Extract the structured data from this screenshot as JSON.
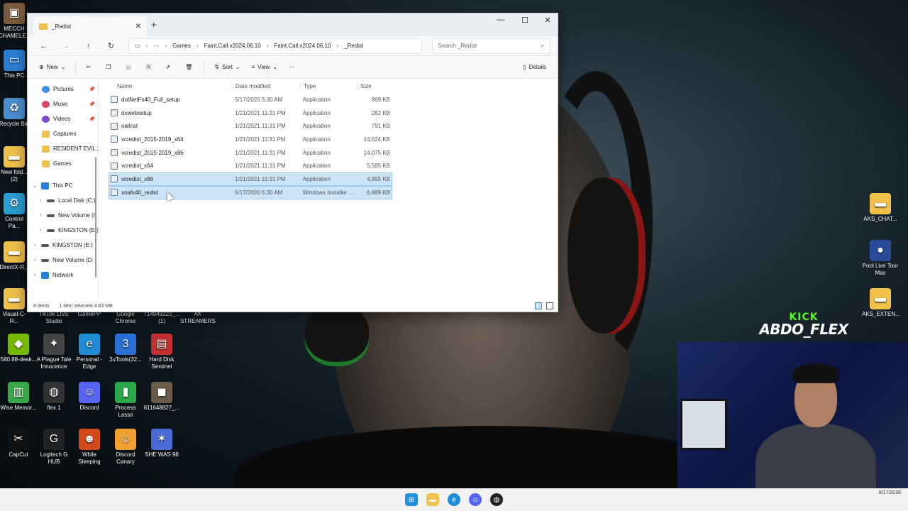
{
  "window": {
    "tab_title": "_Redist",
    "close_tab": "✕",
    "new_tab": "+",
    "minimize": "—",
    "maximize": "☐",
    "close": "✕"
  },
  "address": {
    "crumbs": [
      "Games",
      "Faint.Call.v2024.06.10",
      "Faint.Call.v2024.06.10",
      "_Redist"
    ],
    "search_placeholder": "Search _Redist",
    "more": "···"
  },
  "toolbar": {
    "new_label": "New",
    "sort_label": "Sort",
    "view_label": "View",
    "more": "···",
    "details_label": "Details"
  },
  "sidebar": {
    "items": [
      {
        "label": "Pictures",
        "icon": "pictures-icon",
        "color": "#3a8ee6",
        "pinned": true
      },
      {
        "label": "Music",
        "icon": "music-icon",
        "color": "#d6496b",
        "pinned": true
      },
      {
        "label": "Videos",
        "icon": "videos-icon",
        "color": "#7a4ac9",
        "pinned": true
      },
      {
        "label": "Captures",
        "icon": "folder-icon",
        "color": "#f0c14b",
        "pinned": false
      },
      {
        "label": "RESIDENT EVIL 2",
        "icon": "folder-icon",
        "color": "#f0c14b",
        "pinned": false
      },
      {
        "label": "Games",
        "icon": "folder-icon",
        "color": "#f0c14b",
        "pinned": false
      }
    ],
    "tree": [
      {
        "label": "This PC",
        "icon": "computer-icon",
        "chev": "⌄",
        "indent": 0
      },
      {
        "label": "Local Disk (C:)",
        "icon": "drive-icon",
        "chev": "›",
        "indent": 1
      },
      {
        "label": "New Volume (I",
        "icon": "drive-icon",
        "chev": "›",
        "indent": 1
      },
      {
        "label": "KINGSTON (E:)",
        "icon": "drive-icon",
        "chev": "›",
        "indent": 1
      },
      {
        "label": "KINGSTON (E:)",
        "icon": "drive-icon",
        "chev": "›",
        "indent": 0
      },
      {
        "label": "New Volume (D:",
        "icon": "drive-icon",
        "chev": "›",
        "indent": 0
      },
      {
        "label": "Network",
        "icon": "network-icon",
        "chev": "›",
        "indent": 0
      }
    ]
  },
  "files": {
    "columns": [
      "Name",
      "Date modified",
      "Type",
      "Size"
    ],
    "rows": [
      {
        "name": "dotNetFx40_Full_setup",
        "date": "5/17/2020 5:30 AM",
        "type": "Application",
        "size": "869 KB",
        "selected": false
      },
      {
        "name": "dxwebsetup",
        "date": "1/21/2021 11:31 PM",
        "type": "Application",
        "size": "282 KB",
        "selected": false
      },
      {
        "name": "oalinst",
        "date": "1/21/2021 11:31 PM",
        "type": "Application",
        "size": "791 KB",
        "selected": false
      },
      {
        "name": "vcredist_2015-2019_x64",
        "date": "1/21/2021 11:31 PM",
        "type": "Application",
        "size": "14,624 KB",
        "selected": false
      },
      {
        "name": "vcredist_2015-2019_x86",
        "date": "1/21/2021 11:31 PM",
        "type": "Application",
        "size": "14,075 KB",
        "selected": false
      },
      {
        "name": "vcredist_x64",
        "date": "1/21/2021 11:31 PM",
        "type": "Application",
        "size": "5,585 KB",
        "selected": false
      },
      {
        "name": "vcredist_x86",
        "date": "1/21/2021 11:31 PM",
        "type": "Application",
        "size": "4,955 KB",
        "selected": true
      },
      {
        "name": "xnafx40_redist",
        "date": "5/17/2020 5:30 AM",
        "type": "Windows Installer ...",
        "size": "6,889 KB",
        "selected": true
      }
    ]
  },
  "status": {
    "count": "8 items",
    "selection": "1 item selected  4.83 MB"
  },
  "desktop_icons": [
    {
      "label": "MECCH CHAMELE...",
      "color": "#7a5a3a",
      "glyph": "▣"
    },
    {
      "label": "This PC",
      "color": "#2a7fd4",
      "glyph": "▭"
    },
    {
      "label": "Recycle Bin",
      "color": "#4a8fd0",
      "glyph": "♻"
    },
    {
      "label": "New fold... (2)",
      "color": "#f0c14b",
      "glyph": "▬"
    },
    {
      "label": "Control Pa...",
      "color": "#2a9fd4",
      "glyph": "⚙"
    },
    {
      "label": "DirectX-R...",
      "color": "#f0c14b",
      "glyph": "▬"
    },
    {
      "label": "Visual-C-R...",
      "color": "#f0c14b",
      "glyph": "▬"
    }
  ],
  "desktop_grid": [
    {
      "label": "TikTok LIVE Studio",
      "color": "#111111",
      "glyph": "♪"
    },
    {
      "label": "GamePP",
      "color": "#1e8e3e",
      "glyph": "G"
    },
    {
      "label": "Google Chrome",
      "color": "#dd4b39",
      "glyph": "◉"
    },
    {
      "label": "714949222_... (1)",
      "color": "#666666",
      "glyph": "▣"
    },
    {
      "label": "AK STREAMERS",
      "color": "#f0c14b",
      "glyph": "▬"
    },
    {
      "label": "580.88-desk...",
      "color": "#76b900",
      "glyph": "◆"
    },
    {
      "label": "A Plague Tale Innocence",
      "color": "#444444",
      "glyph": "✦"
    },
    {
      "label": "Personal - Edge",
      "color": "#1f8cd6",
      "glyph": "e"
    },
    {
      "label": "3uTools(32...",
      "color": "#2a6fd6",
      "glyph": "3"
    },
    {
      "label": "Hard Disk Sentinel",
      "color": "#c03030",
      "glyph": "▤"
    },
    {
      "label": "Wise Memor...",
      "color": "#3aa84a",
      "glyph": "▥"
    },
    {
      "label": "flex 1",
      "color": "#333333",
      "glyph": "◍"
    },
    {
      "label": "Discord",
      "color": "#5865f2",
      "glyph": "☺"
    },
    {
      "label": "Process Lasso",
      "color": "#2aa84a",
      "glyph": "▮"
    },
    {
      "label": "611648827_...",
      "color": "#6a5a4a",
      "glyph": "◼"
    },
    {
      "label": "CapCut",
      "color": "#111111",
      "glyph": "✂"
    },
    {
      "label": "Logitech G HUB",
      "color": "#222222",
      "glyph": "G"
    },
    {
      "label": "While Sleeping",
      "color": "#d04a1a",
      "glyph": "☻"
    },
    {
      "label": "Discord Canary",
      "color": "#f0a030",
      "glyph": "☺"
    },
    {
      "label": "SHE WAS 98",
      "color": "#4a6ad6",
      "glyph": "✶"
    }
  ],
  "desktop_right": [
    {
      "label": "AKS_CHAT...",
      "color": "#f0c14b",
      "glyph": "▬"
    },
    {
      "label": "Pool Live Tour Max",
      "color": "#2a4a9a",
      "glyph": "●"
    },
    {
      "label": "AKS_EXTEN...",
      "color": "#f0c14b",
      "glyph": "▬"
    }
  ],
  "overlay": {
    "kick_top": "KICK",
    "kick_name": "ABDO_FLEX"
  },
  "taskbar": {
    "date": "8/17/2026"
  }
}
